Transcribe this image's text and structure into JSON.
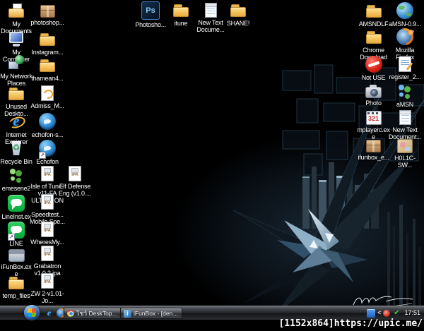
{
  "desktop": {
    "icons": [
      {
        "label": "My Documents",
        "icon": "folder-document"
      },
      {
        "label": "My Computer",
        "icon": "computer"
      },
      {
        "label": "My Network Places",
        "icon": "network-places"
      },
      {
        "label": "Unused Deskto...",
        "icon": "folder"
      },
      {
        "label": "Internet Explorer",
        "icon": "internet-explorer"
      },
      {
        "label": "Recycle Bin",
        "icon": "recycle-bin"
      },
      {
        "label": "emesene2",
        "icon": "people-green"
      },
      {
        "label": "LineInst.exe",
        "icon": "line-app"
      },
      {
        "label": "LINE",
        "icon": "line-app-shortcut"
      },
      {
        "label": "iFunBox.exe",
        "icon": "gray-drive"
      },
      {
        "label": "temp_files",
        "icon": "folder"
      },
      {
        "label": "photoshop...",
        "icon": "cardboard-box"
      },
      {
        "label": "Instagram...",
        "icon": "folder"
      },
      {
        "label": "thamean4...",
        "icon": "folder"
      },
      {
        "label": "Admiss_M...",
        "icon": "document-swirl"
      },
      {
        "label": "echofon-s...",
        "icon": "echofon-orb"
      },
      {
        "label": "Echofon",
        "icon": "echofon-orb-shortcut"
      },
      {
        "label": "Isle of Tune-v11-FA ULTYCLONE",
        "icon": "ipa-file"
      },
      {
        "label": "Speedtest... Mobile Spe...",
        "icon": "ipa-file"
      },
      {
        "label": "WheresMy...",
        "icon": "ipa-file"
      },
      {
        "label": "Grabatron v1.0.2.ipa",
        "icon": "ipa-file"
      },
      {
        "label": "ZW 2-v1.01-Jo...",
        "icon": "ipa-file"
      },
      {
        "label": "Elf Defense Eng (v1.0....",
        "icon": "ipa-file"
      },
      {
        "label": "Photosho...",
        "icon": "photoshop-ps"
      },
      {
        "label": "itune",
        "icon": "folder"
      },
      {
        "label": "New Text Docume...",
        "icon": "notepad"
      },
      {
        "label": "SHANE!",
        "icon": "folder"
      },
      {
        "label": "AMSNDLF",
        "icon": "folder"
      },
      {
        "label": "Chrome Download",
        "icon": "folder"
      },
      {
        "label": "Not USE",
        "icon": "no-entry"
      },
      {
        "label": "Photo",
        "icon": "camera"
      },
      {
        "label": "mplayerc.exe",
        "icon": "media-player-classic"
      },
      {
        "label": "ifunbox_e...",
        "icon": "cardboard-box"
      },
      {
        "label": "aMSN-0.9...",
        "icon": "globe-sphere"
      },
      {
        "label": "Mozilla Firefox",
        "icon": "firefox"
      },
      {
        "label": "register_2...",
        "icon": "register-document"
      },
      {
        "label": "aMSN",
        "icon": "people-blue"
      },
      {
        "label": "New Text Document...",
        "icon": "notepad"
      },
      {
        "label": "H0L1C-SW...",
        "icon": "image-thumbnail"
      }
    ]
  },
  "taskbar": {
    "quick_launch": [
      {
        "icon": "internet-explorer"
      },
      {
        "icon": "firefox"
      },
      {
        "icon": "chrome"
      }
    ],
    "overflow_chevron": "»",
    "tasks": [
      {
        "icon": "chrome",
        "label": "โชว์ DeskTop กันอะ..."
      },
      {
        "icon": "ifunbox",
        "label": "iFunBox - [denwit'..."
      }
    ],
    "tray": {
      "chevron": "<",
      "icons": [
        "language-indicator",
        "messenger-status",
        "update-ok"
      ],
      "clock": "17:51"
    }
  },
  "watermark": {
    "resolution": "[1152x864]",
    "site": "https://upic.me/"
  },
  "colors": {
    "desktop_bg": "#000000",
    "icon_label": "#ffffff",
    "taskbar_dark": "#2b2d31",
    "wallpaper_accent": "#8fb0c6",
    "clock_text": "#f0f0f0"
  }
}
